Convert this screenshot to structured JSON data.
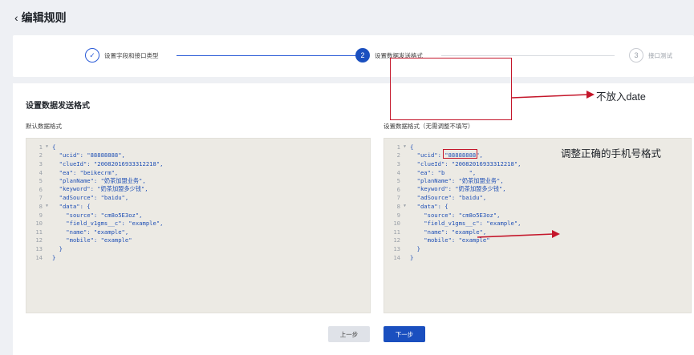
{
  "header": {
    "back_icon": "chevron-left-icon",
    "title": "编辑规则"
  },
  "steps": [
    {
      "index": "✓",
      "label": "设置字段和接口类型",
      "state": "done"
    },
    {
      "index": "2",
      "label": "设置数据发送格式",
      "state": "active"
    },
    {
      "index": "3",
      "label": "接口测试",
      "state": "pending"
    }
  ],
  "section": {
    "title": "设置数据发送格式",
    "default_label": "默认数据格式",
    "custom_label": "设置数据格式（无需调整不填写）"
  },
  "default_code": [
    "{",
    "  \"ucid\": \"88888888\",",
    "  \"clueId\": \"20082016933312218\",",
    "  \"ea\": \"beikecrm\",",
    "  \"planName\": \"奶茶加盟业务\",",
    "  \"keyword\": \"奶茶加盟多少钱\",",
    "  \"adSource\": \"baidu\",",
    "  \"data\": {",
    "    \"source\": \"cm8o5E3oz\",",
    "    \"field_v1gms__c\": \"example\",",
    "    \"name\": \"example\",",
    "    \"mobile\": \"example\"",
    "  }",
    "}"
  ],
  "custom_code": [
    "{",
    "  \"ucid\": \"88888888\",",
    "  \"clueId\": \"20082016933312218\",",
    "  \"ea\": \"b       \",",
    "  \"planName\": \"奶茶加盟业务\",",
    "  \"keyword\": \"奶茶加盟多少钱\",",
    "  \"adSource\": \"baidu\",",
    "  \"data\": {",
    "    \"source\": \"cm8o5E3oz\",",
    "    \"field_v1gms__c\": \"example\",",
    "    \"name\": \"example\",",
    "    \"mobile\": \"example\"",
    "  }",
    "}"
  ],
  "annotations": {
    "a1": "不放入date",
    "a2": "调整正确的手机号格式"
  },
  "buttons": {
    "prev": "上一步",
    "next": "下一步"
  },
  "colors": {
    "primary": "#1a4fbf",
    "annotation": "#c4162a"
  }
}
